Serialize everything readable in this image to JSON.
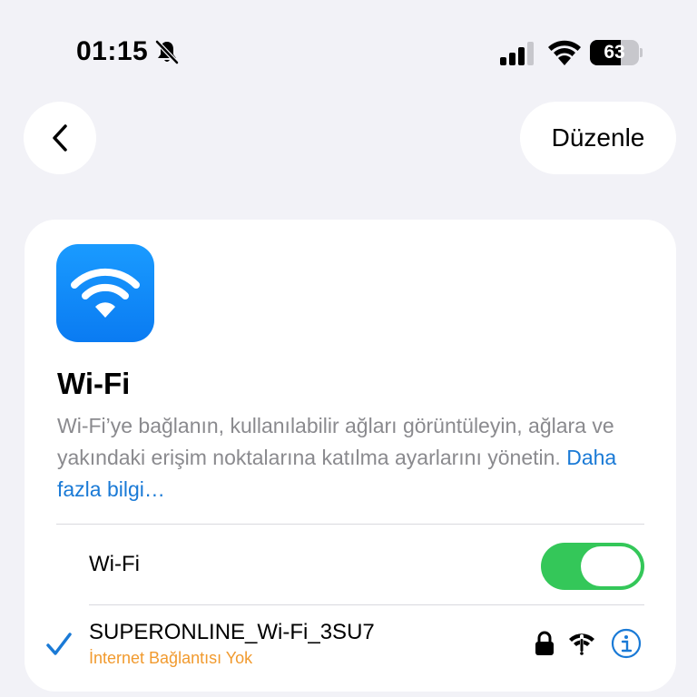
{
  "status_bar": {
    "time": "01:15",
    "battery_level": "63",
    "battery_fraction": 0.63,
    "silent_mode": true,
    "icons": [
      "bell-slash-icon",
      "cellular-signal-icon",
      "wifi-icon",
      "battery-icon"
    ]
  },
  "nav": {
    "back_icon": "chevron-left-icon",
    "edit_label": "Düzenle"
  },
  "header": {
    "icon": "wifi-app-icon",
    "title": "Wi-Fi",
    "description": "Wi-Fi’ye bağlanın, kullanılabilir ağları görüntüleyin, ağlara ve yakındaki erişim noktalarına katılma ayarlarını yönetin.",
    "learn_more": "Daha fazla bilgi…"
  },
  "wifi_toggle": {
    "label": "Wi-Fi",
    "on": true
  },
  "current_network": {
    "name": "SUPERONLINE_Wi-Fi_3SU7",
    "status": "İnternet Bağlantısı Yok",
    "connected": true,
    "icons": [
      "checkmark-icon",
      "lock-icon",
      "wifi-exclamation-icon",
      "info-icon"
    ]
  },
  "colors": {
    "accent_blue": "#1a7ad6",
    "toggle_green": "#34c759",
    "warning_orange": "#f19a2e",
    "background": "#f2f2f7"
  }
}
